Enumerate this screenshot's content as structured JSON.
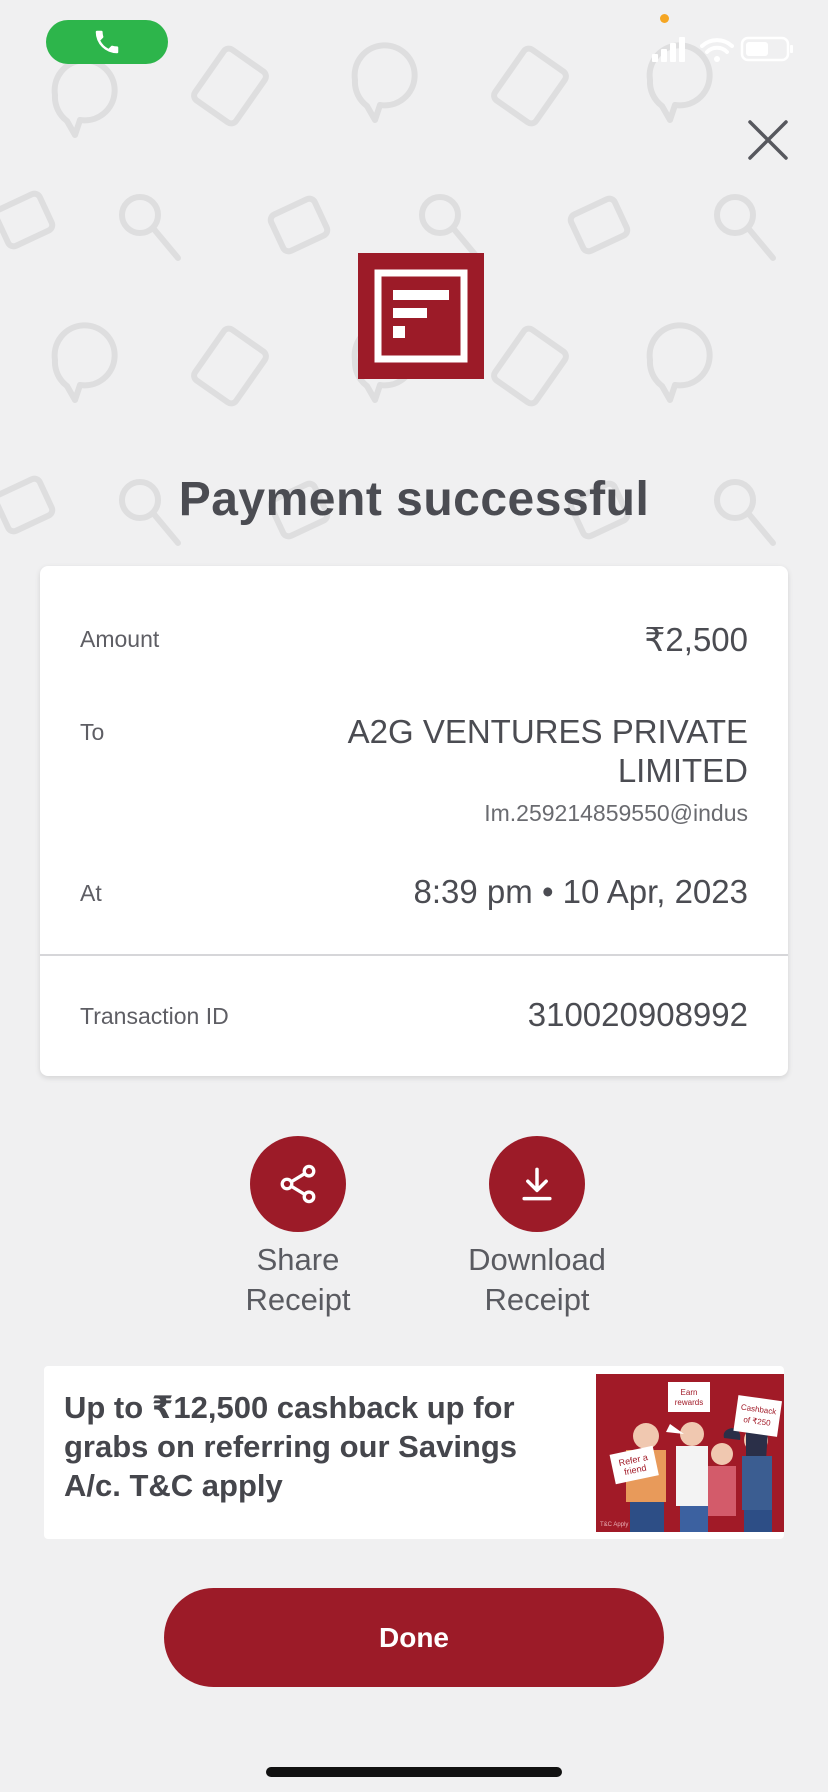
{
  "status": {
    "call_color": "#2db54b",
    "icons": [
      "phone-icon",
      "signal-icon",
      "wifi-icon",
      "battery-icon"
    ]
  },
  "header": {
    "close_icon": "close-icon",
    "logo_icon": "bank-logo-icon",
    "title": "Payment successful"
  },
  "card": {
    "amount_label": "Amount",
    "amount_value": "₹2,500",
    "to_label": "To",
    "to_name_line1": "A2G VENTURES PRIVATE",
    "to_name_line2": "LIMITED",
    "to_upi": "Im.259214859550@indus",
    "at_label": "At",
    "at_value": "8:39 pm • 10 Apr, 2023",
    "txn_label": "Transaction ID",
    "txn_value": "310020908992"
  },
  "actions": {
    "share_line1": "Share",
    "share_line2": "Receipt",
    "download_line1": "Download",
    "download_line2": "Receipt"
  },
  "promo": {
    "text": "Up to ₹12,500 cashback up for grabs on referring our Savings A/c. T&C apply",
    "sign_left": "Refer a friend",
    "sign_middle": "Earn rewards",
    "sign_right": "Cashback of ₹250",
    "image_caption": "T&C Apply"
  },
  "footer": {
    "done_label": "Done"
  },
  "colors": {
    "brand": "#9c1b28",
    "background": "#f0f0f1",
    "text": "#4b4c52"
  }
}
